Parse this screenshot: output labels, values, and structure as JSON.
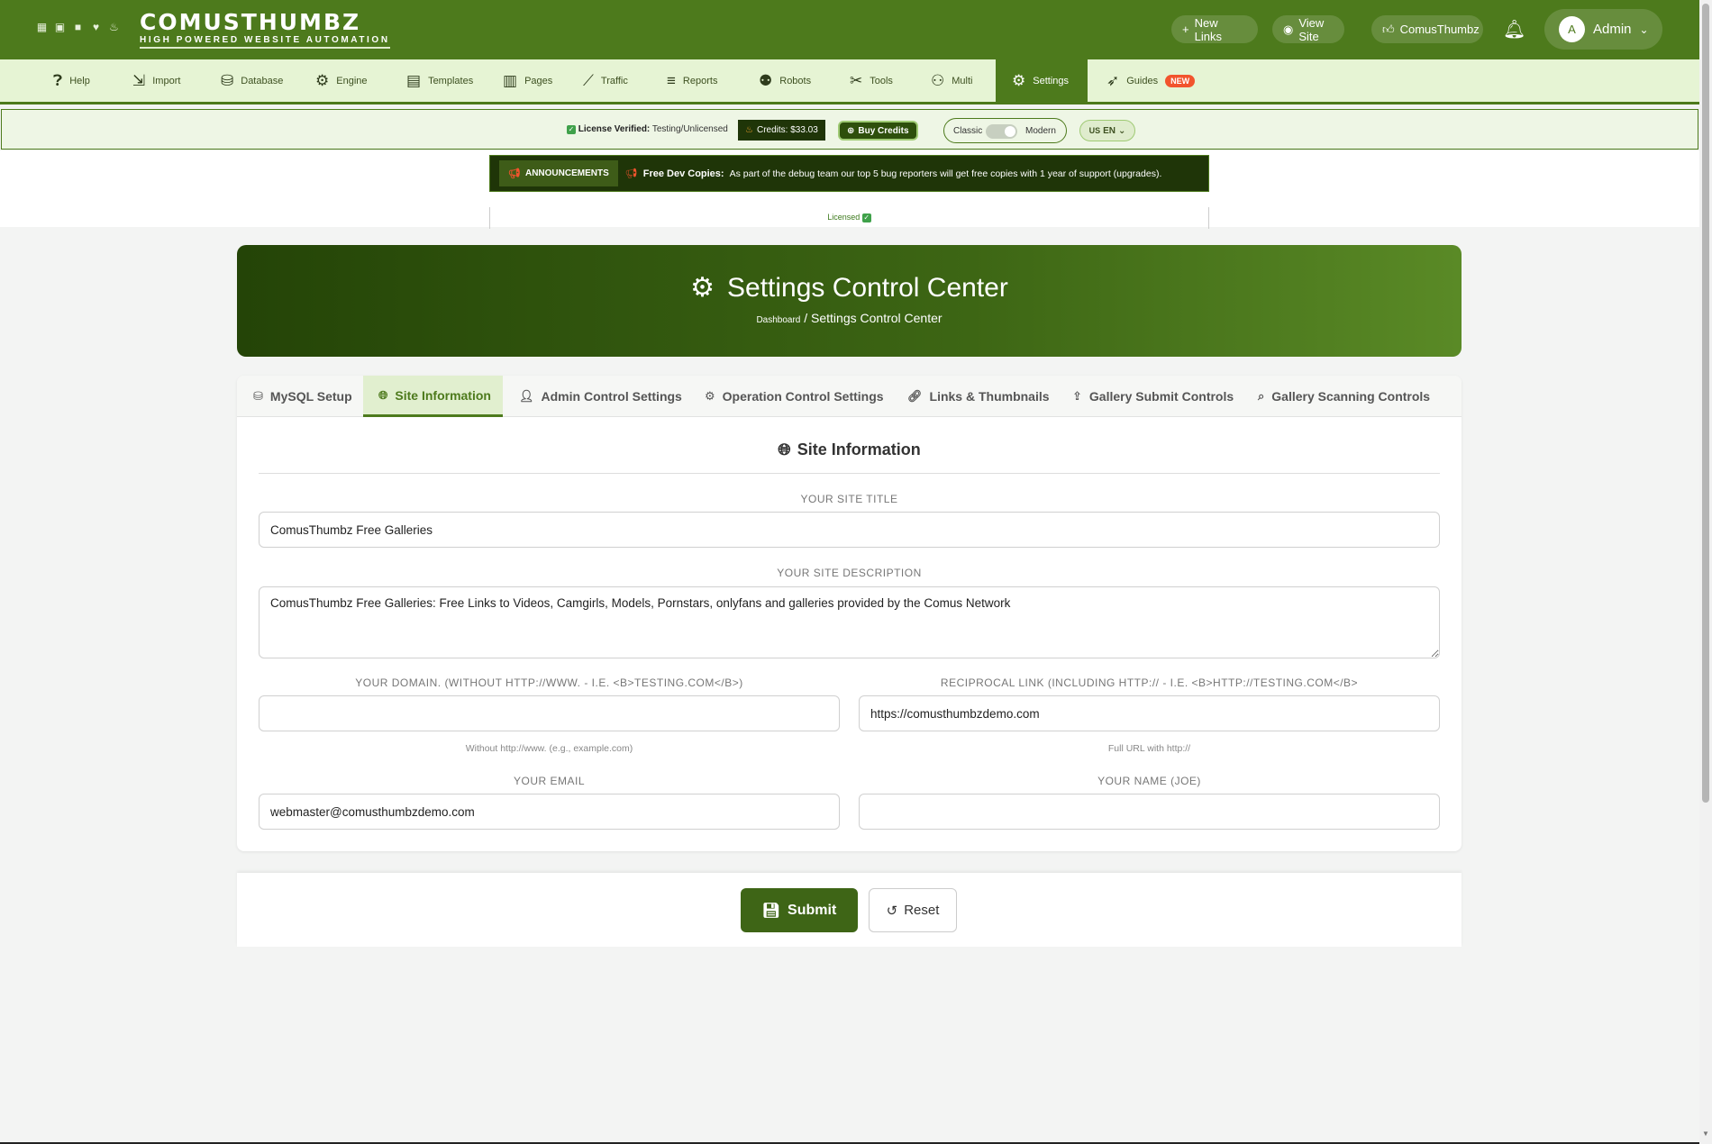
{
  "header": {
    "brand_name": "COMUSTHUMBZ",
    "brand_tagline": "HIGH POWERED WEBSITE AUTOMATION",
    "logo_icons": [
      "image-icon",
      "gallery-icon",
      "video-icon",
      "heart-icon",
      "fire-icon"
    ],
    "new_links": "New Links",
    "view_site": "View Site",
    "comus_link": "ComusThumbz",
    "user_initial": "A",
    "user_name": "Admin"
  },
  "nav": {
    "items": [
      {
        "label": "Help",
        "icon": "help-icon"
      },
      {
        "label": "Import",
        "icon": "import-icon"
      },
      {
        "label": "Database",
        "icon": "database-icon"
      },
      {
        "label": "Engine",
        "icon": "engine-icon"
      },
      {
        "label": "Templates",
        "icon": "templates-icon"
      },
      {
        "label": "Pages",
        "icon": "pages-icon"
      },
      {
        "label": "Traffic",
        "icon": "traffic-icon"
      },
      {
        "label": "Reports",
        "icon": "reports-icon"
      },
      {
        "label": "Robots",
        "icon": "robot-icon"
      },
      {
        "label": "Tools",
        "icon": "tools-icon"
      },
      {
        "label": "Multi",
        "icon": "multi-icon"
      },
      {
        "label": "Settings",
        "icon": "gear-icon"
      },
      {
        "label": "Guides",
        "icon": "rocket-icon"
      }
    ],
    "active": "Settings",
    "new_badge": "NEW"
  },
  "license": {
    "verified_label": "License Verified:",
    "verified_value": "Testing/Unlicensed",
    "credits": "Credits: $33.03",
    "buy_credits": "Buy Credits",
    "mode_classic": "Classic",
    "mode_modern": "Modern",
    "lang_flag": "US",
    "lang": "EN"
  },
  "announcement": {
    "tag": "ANNOUNCEMENTS",
    "title": "Free Dev Copies:",
    "message": "As part of the debug team our top 5 bug reporters will get free copies with 1 year of support (upgrades).",
    "licensed": "Licensed"
  },
  "hero": {
    "title": "Settings Control Center",
    "crumb_root": "Dashboard",
    "crumb_sep": "/",
    "crumb_current": "Settings Control Center"
  },
  "tabs": [
    {
      "label": "MySQL Setup",
      "icon": "database-icon"
    },
    {
      "label": "Site Information",
      "icon": "globe-icon"
    },
    {
      "label": "Admin Control Settings",
      "icon": "user-gear-icon"
    },
    {
      "label": "Operation Control Settings",
      "icon": "gears-icon"
    },
    {
      "label": "Links & Thumbnails",
      "icon": "link-icon"
    },
    {
      "label": "Gallery Submit Controls",
      "icon": "upload-icon"
    },
    {
      "label": "Gallery Scanning Controls",
      "icon": "search-icon"
    }
  ],
  "active_tab": "Site Information",
  "form": {
    "section_title": "Site Information",
    "site_title_label": "YOUR SITE TITLE",
    "site_title_value": "ComusThumbz Free Galleries",
    "site_desc_label": "YOUR SITE DESCRIPTION",
    "site_desc_value": "ComusThumbz Free Galleries: Free Links to Videos, Camgirls, Models, Pornstars, onlyfans and galleries provided by the Comus Network",
    "domain_label": "YOUR DOMAIN. (WITHOUT HTTP://WWW. - I.E. <B>TESTING.COM</B>)",
    "domain_value": "",
    "domain_help": "Without http://www. (e.g., example.com)",
    "recip_label": "RECIPROCAL LINK (INCLUDING HTTP:// - I.E. <B>HTTP://TESTING.COM</B>",
    "recip_value": "https://comusthumbzdemo.com",
    "recip_help": "Full URL with http://",
    "email_label": "YOUR EMAIL",
    "email_value": "webmaster@comusthumbzdemo.com",
    "name_label": "YOUR NAME (JOE)",
    "name_value": ""
  },
  "actions": {
    "submit": "Submit",
    "reset": "Reset"
  }
}
